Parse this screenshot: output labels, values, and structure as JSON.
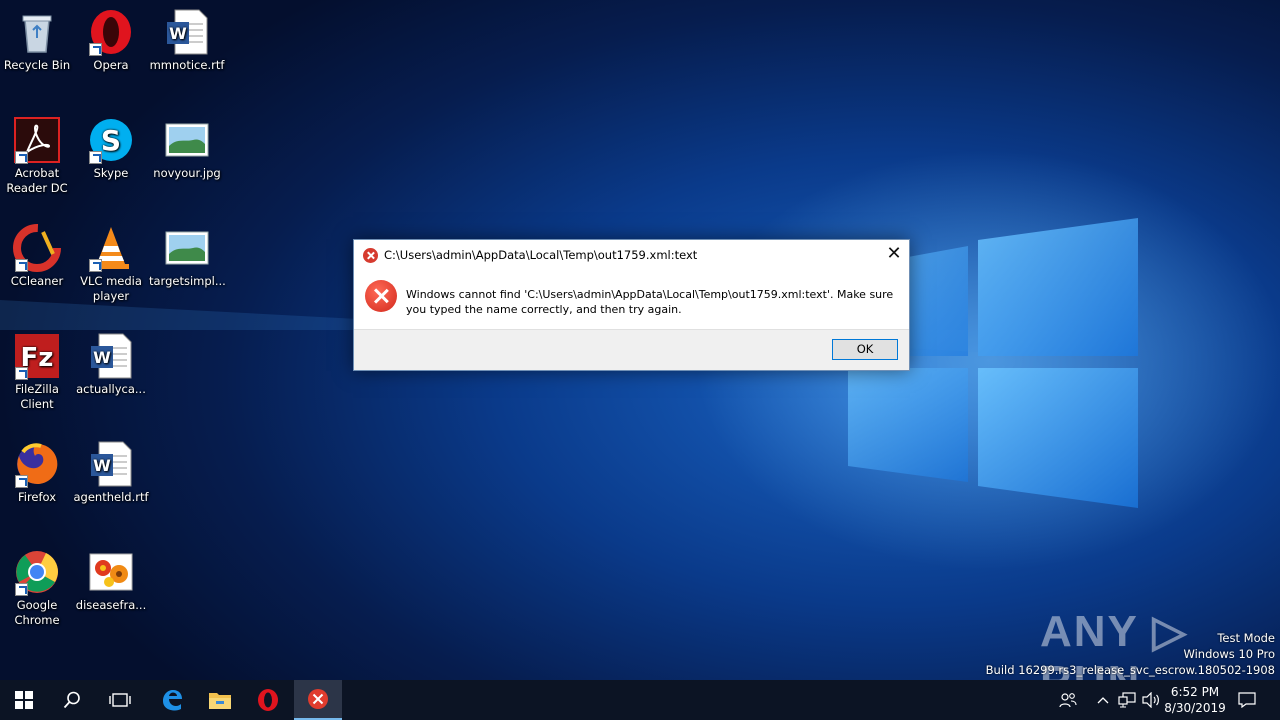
{
  "desktop": {
    "icons": [
      {
        "label": "Recycle Bin",
        "icon": "recycle-bin-icon"
      },
      {
        "label": "Opera",
        "icon": "opera-icon"
      },
      {
        "label": "mmnotice.rtf",
        "icon": "word-document-icon"
      },
      {
        "label": "Acrobat Reader DC",
        "icon": "acrobat-icon"
      },
      {
        "label": "Skype",
        "icon": "skype-icon"
      },
      {
        "label": "novyour.jpg",
        "icon": "image-file-icon"
      },
      {
        "label": "CCleaner",
        "icon": "ccleaner-icon"
      },
      {
        "label": "VLC media player",
        "icon": "vlc-icon"
      },
      {
        "label": "targetsimpl...",
        "icon": "image-file-icon"
      },
      {
        "label": "FileZilla Client",
        "icon": "filezilla-icon"
      },
      {
        "label": "actuallyca...",
        "icon": "word-document-icon"
      },
      {
        "label": "Firefox",
        "icon": "firefox-icon"
      },
      {
        "label": "agentheld.rtf",
        "icon": "word-document-icon"
      },
      {
        "label": "Google Chrome",
        "icon": "chrome-icon"
      },
      {
        "label": "diseasefra...",
        "icon": "flower-image-icon"
      }
    ]
  },
  "dialog": {
    "title": "C:\\Users\\admin\\AppData\\Local\\Temp\\out1759.xml:text",
    "message": "Windows cannot find 'C:\\Users\\admin\\AppData\\Local\\Temp\\out1759.xml:text'. Make sure you typed the name correctly, and then try again.",
    "ok_label": "OK",
    "close_glyph": "✕"
  },
  "watermark": {
    "text": "ANY ▷ RUN"
  },
  "system_info": {
    "line1": "Test Mode",
    "line2": "Windows 10 Pro",
    "line3": "Build 16299.rs3_release_svc_escrow.180502-1908"
  },
  "taskbar": {
    "clock_time": "6:52 PM",
    "clock_date": "8/30/2019"
  },
  "colors": {
    "accent": "#0078d7",
    "error_red": "#d63b2f",
    "taskbar": "#0c1424"
  }
}
